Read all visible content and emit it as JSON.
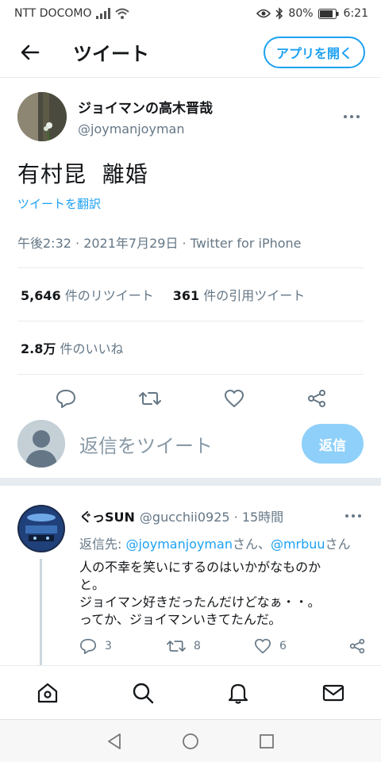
{
  "status_bar": {
    "carrier": "NTT DOCOMO",
    "battery": "80%",
    "time": "6:21",
    "icons": [
      "signal-icon",
      "wifi-icon",
      "eye-icon",
      "bluetooth-icon",
      "battery-icon"
    ]
  },
  "header": {
    "title": "ツイート",
    "open_app_label": "アプリを開く",
    "accent": "#1da1f2"
  },
  "tweet": {
    "display_name": "ジョイマンの高木晋哉",
    "handle": "@joymanjoyman",
    "text": "有村昆  離婚",
    "translate_label": "ツイートを翻訳",
    "meta": "午後2:32 · 2021年7月29日 · Twitter for iPhone",
    "retweets_count": "5,646",
    "retweets_label": "件のリツイート",
    "quotes_count": "361",
    "quotes_label": "件の引用ツイート",
    "likes_count": "2.8万",
    "likes_label": "件のいいね"
  },
  "compose": {
    "placeholder": "返信をツイート",
    "reply_label": "返信"
  },
  "reply": {
    "display_name": "ぐっSUN",
    "handle_time": "@gucchii0925 · 15時間",
    "reply_to_prefix": "返信先: ",
    "mention1": "@joymanjoyman",
    "san1": "さん、",
    "mention2": "@mrbuu",
    "san2": "さん",
    "line1": "人の不幸を笑いにするのはいかがなものか",
    "line2": "と。",
    "line3": "ジョイマン好きだったんだけどなぁ・・。",
    "line4": "ってか、ジョイマンいきてたんだ。",
    "reply_count": "3",
    "retweet_count": "8",
    "like_count": "6"
  },
  "bottom_nav": [
    "home-icon",
    "search-icon",
    "notifications-icon",
    "messages-icon"
  ]
}
